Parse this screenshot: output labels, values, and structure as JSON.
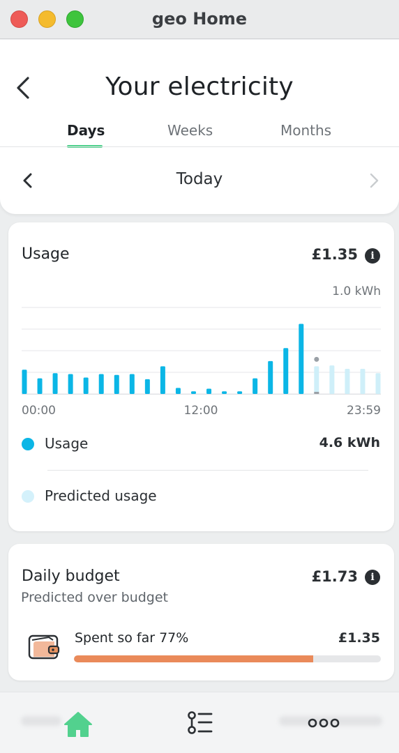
{
  "window": {
    "title": "geo Home"
  },
  "header": {
    "title": "Your electricity",
    "tabs": [
      {
        "label": "Days",
        "active": true
      },
      {
        "label": "Weeks",
        "active": false
      },
      {
        "label": "Months",
        "active": false
      }
    ],
    "date_label": "Today"
  },
  "usage": {
    "title": "Usage",
    "amount": "£1.35",
    "chart_data": {
      "type": "bar",
      "y_top_label": "1.0 kWh",
      "x_tick_labels": [
        "00:00",
        "12:00",
        "23:59"
      ],
      "series": [
        {
          "name": "Usage",
          "color": "#0bb6e6",
          "values": [
            0.28,
            0.18,
            0.24,
            0.23,
            0.19,
            0.23,
            0.22,
            0.23,
            0.17,
            0.32,
            0.07,
            0.03,
            0.06,
            0.03,
            0.03,
            0.18,
            0.38,
            0.53,
            0.81
          ]
        },
        {
          "name": "Predicted usage",
          "color": "#cfeff9",
          "values": [
            0.32,
            0.33,
            0.29,
            0.29,
            0.24
          ]
        }
      ],
      "current_marker_value": 0.4,
      "ylim": [
        0,
        1.0
      ]
    },
    "legend": [
      {
        "label": "Usage",
        "value": "4.6 kWh",
        "color": "#0bb6e6"
      },
      {
        "label": "Predicted usage",
        "value": "",
        "color": "#d4f1fb"
      }
    ]
  },
  "budget": {
    "title": "Daily budget",
    "amount": "£1.73",
    "subtitle": "Predicted over budget",
    "spent_label": "Spent so far 77%",
    "spent_value": "£1.35",
    "progress_fraction": 0.78
  },
  "nav": {
    "items": [
      {
        "icon": "home-icon",
        "active": true
      },
      {
        "icon": "list-icon",
        "active": false
      },
      {
        "icon": "more-icon",
        "active": false
      }
    ]
  },
  "colors": {
    "accent": "#52d18e",
    "usage": "#0bb6e6",
    "predicted": "#cfeff9",
    "budget_bar": "#ea8a5a"
  }
}
